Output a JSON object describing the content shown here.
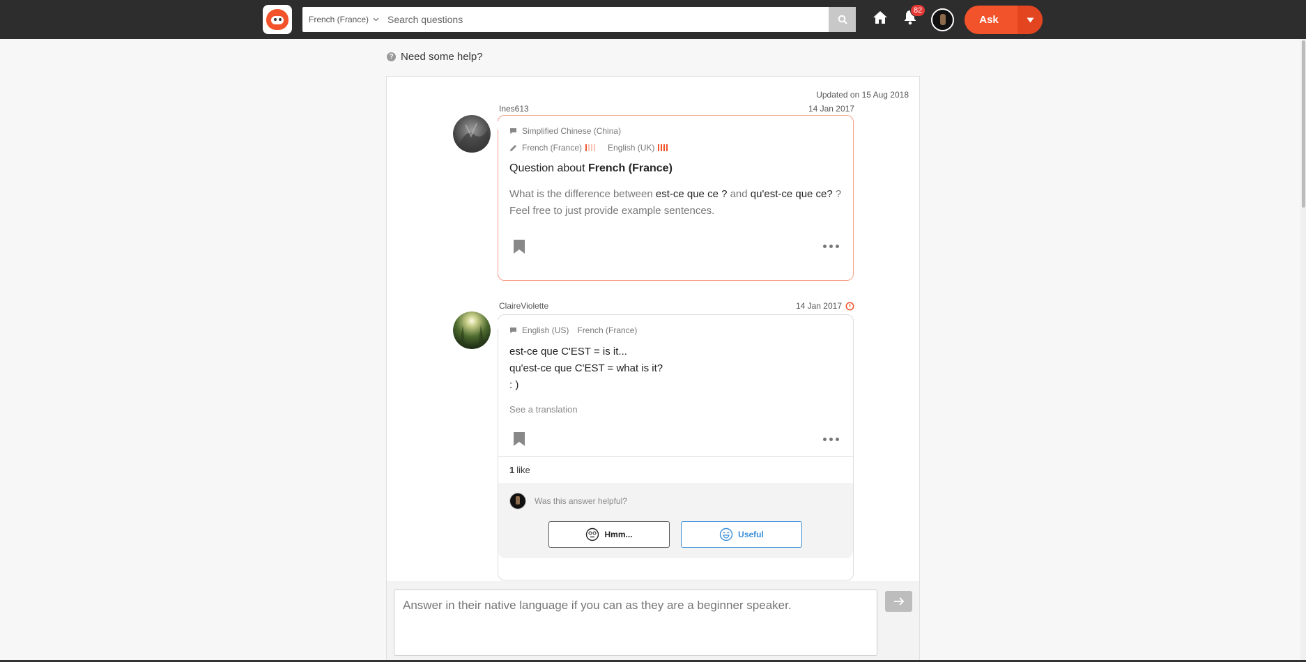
{
  "nav": {
    "language": "French (France)",
    "search_placeholder": "Search questions",
    "notification_count": "82",
    "ask_label": "Ask"
  },
  "help": {
    "label": "Need some help?"
  },
  "question": {
    "updated": "Updated on 15 Aug 2018",
    "author": "Ines613",
    "date": "14 Jan 2017",
    "native_language": "Simplified Chinese (China)",
    "learning": [
      {
        "name": "French (France)",
        "level": "beginner"
      },
      {
        "name": "English (UK)",
        "level": "advanced"
      }
    ],
    "title_prefix": "Question about",
    "title_language": "French (France)",
    "body": {
      "part1": "What is the difference between ",
      "term1": "est-ce que ce ?",
      "part2": " and ",
      "term2": "qu'est-ce que ce?",
      "part3": " ?Feel free to just provide example sentences."
    }
  },
  "answer": {
    "author": "ClaireViolette",
    "date": "14 Jan 2017",
    "languages": "English (US)",
    "languages2": "French (France)",
    "text": "est-ce que C'EST = is it...\nqu'est-ce que C'EST = what is it?\n: )",
    "see_translation": "See a translation",
    "likes_count": "1",
    "likes_label": "like",
    "helpful_question": "Was this answer helpful?",
    "hmm_label": "Hmm...",
    "useful_label": "Useful"
  },
  "composer": {
    "placeholder": "Answer in their native language if you can as they are a beginner speaker."
  },
  "colors": {
    "brand": "#f3532b",
    "topbar": "#2d2d2d",
    "useful": "#3a8fd9"
  },
  "icons": [
    "logo-icon",
    "chevron-down-icon",
    "search-icon",
    "home-icon",
    "bell-icon",
    "speech-bubble-icon",
    "pencil-icon",
    "bookmark-icon",
    "more-icon",
    "timer-icon",
    "hmm-face-icon",
    "smile-face-icon",
    "arrow-right-icon",
    "question-circle-icon"
  ]
}
